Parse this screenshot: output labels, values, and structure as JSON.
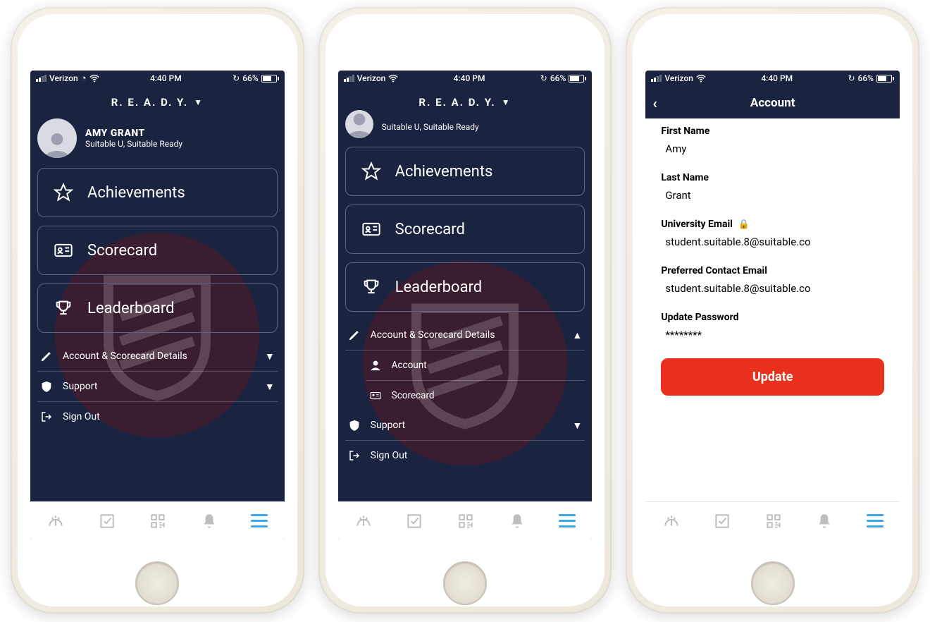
{
  "status": {
    "carrier": "Verizon",
    "time": "4:40 PM",
    "battery": "66%"
  },
  "header": {
    "program": "R. E. A. D. Y."
  },
  "user": {
    "name": "AMY GRANT",
    "subtitle": "Suitable U, Suitable Ready"
  },
  "tiles": {
    "achievements": "Achievements",
    "scorecard": "Scorecard",
    "leaderboard": "Leaderboard"
  },
  "menu": {
    "account_details": "Account & Scorecard Details",
    "support": "Support",
    "signout": "Sign Out",
    "sub_account": "Account",
    "sub_scorecard": "Scorecard"
  },
  "account": {
    "title": "Account",
    "first_name_label": "First Name",
    "first_name": "Amy",
    "last_name_label": "Last Name",
    "last_name": "Grant",
    "uni_email_label": "University Email",
    "uni_email": "student.suitable.8@suitable.co",
    "pref_email_label": "Preferred Contact Email",
    "pref_email": "student.suitable.8@suitable.co",
    "password_label": "Update Password",
    "password_mask": "********",
    "update_btn": "Update"
  }
}
